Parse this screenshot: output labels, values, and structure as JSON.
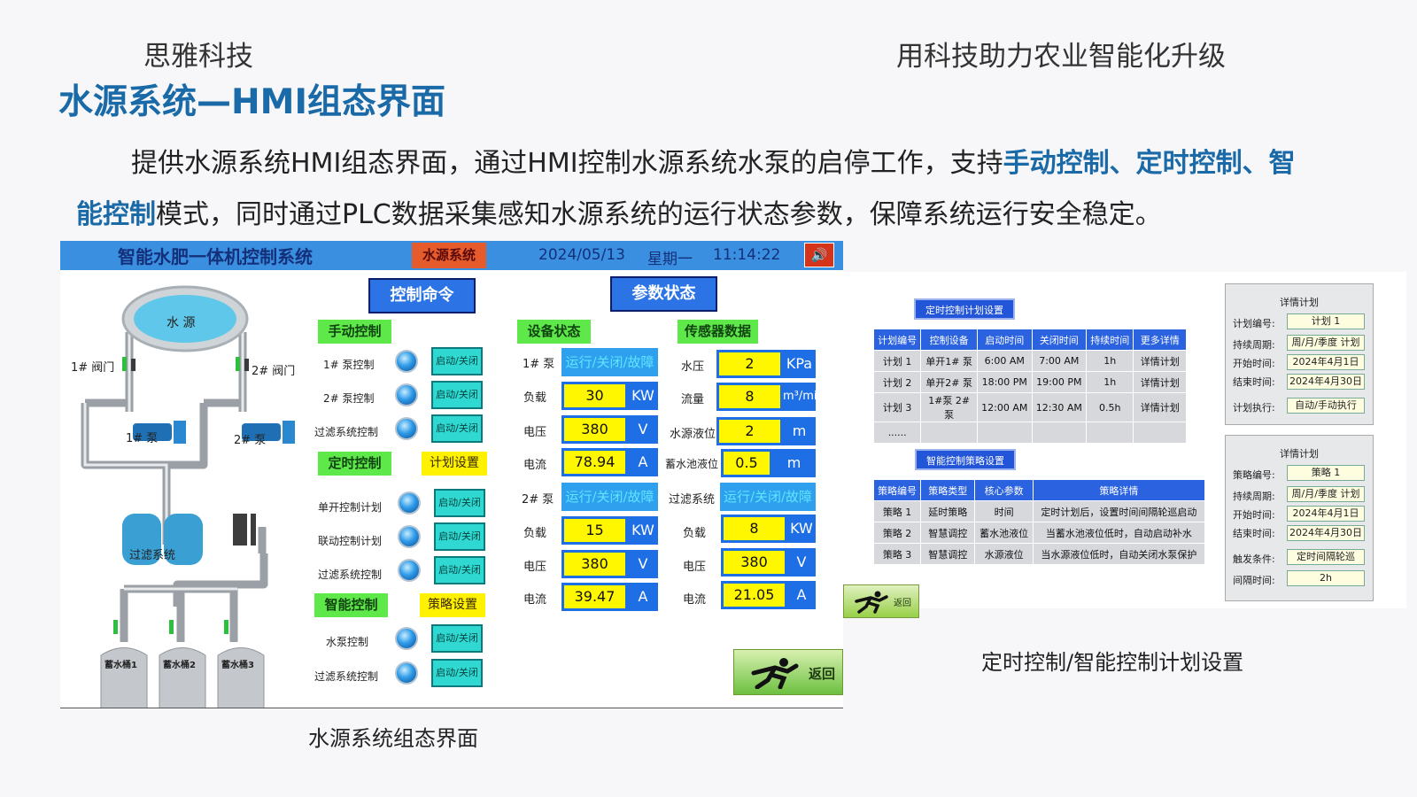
{
  "header": {
    "company": "思雅科技",
    "slogan": "用科技助力农业智能化升级",
    "title": "水源系统—HMI组态界面"
  },
  "description": {
    "p1": "提供水源系统HMI组态界面，通过HMI控制水源系统水泵的启停工作，支持",
    "h1": "手动控制、定时控制、智",
    "h2": "能控制",
    "p2": "模式，同时通过PLC数据采集感知水源系统的运行状态参数，保障系统运行安全稳定。"
  },
  "hmi": {
    "titlebar": {
      "title": "智能水肥一体机控制系统",
      "system": "水源系统",
      "date": "2024/05/13",
      "weekday": "星期一",
      "time": "11:14:22",
      "speaker": "🔊"
    },
    "diagram": {
      "water_source": "水 源",
      "valve1": "1# 阀门",
      "valve2": "2# 阀门",
      "pump1": "1# 泵",
      "pump2": "2# 泵",
      "filter": "过滤系统",
      "tank1": "蓄水桶1",
      "tank2": "蓄水桶2",
      "tank3": "蓄水桶3"
    },
    "control": {
      "header": "控制命令",
      "manual": {
        "label": "手动控制",
        "rows": [
          {
            "label": "1# 泵控制",
            "btn": "启动/关闭"
          },
          {
            "label": "2# 泵控制",
            "btn": "启动/关闭"
          },
          {
            "label": "过滤系统控制",
            "btn": "启动/关闭"
          }
        ]
      },
      "timed": {
        "label": "定时控制",
        "setting": "计划设置",
        "rows": [
          {
            "label": "单开控制计划",
            "btn": "启动/关闭"
          },
          {
            "label": "联动控制计划",
            "btn": "启动/关闭"
          },
          {
            "label": "过滤系统控制",
            "btn": "启动/关闭"
          }
        ]
      },
      "smart": {
        "label": "智能控制",
        "setting": "策略设置",
        "rows": [
          {
            "label": "水泵控制",
            "btn": "启动/关闭"
          },
          {
            "label": "过滤系统控制",
            "btn": "启动/关闭"
          }
        ]
      }
    },
    "params": {
      "header": "参数状态",
      "device_header": "设备状态",
      "sensor_header": "传感器数据",
      "pump1": {
        "label": "1# 泵",
        "status": "运行/关闭/故障",
        "load_label": "负载",
        "load": "30",
        "load_unit": "KW",
        "volt_label": "电压",
        "volt": "380",
        "volt_unit": "V",
        "cur_label": "电流",
        "cur": "78.94",
        "cur_unit": "A"
      },
      "pump2": {
        "label": "2# 泵",
        "status": "运行/关闭/故障",
        "load_label": "负载",
        "load": "15",
        "load_unit": "KW",
        "volt_label": "电压",
        "volt": "380",
        "volt_unit": "V",
        "cur_label": "电流",
        "cur": "39.47",
        "cur_unit": "A"
      },
      "sensors": {
        "pressure_label": "水压",
        "pressure": "2",
        "pressure_unit": "KPa",
        "flow_label": "流量",
        "flow": "8",
        "flow_unit": "m³/min",
        "level_label": "水源液位",
        "level": "2",
        "level_unit": "m",
        "pool_label": "蓄水池液位",
        "pool": "0.5",
        "pool_unit": "m"
      },
      "filter": {
        "label": "过滤系统",
        "status": "运行/关闭/故障",
        "load_label": "负载",
        "load": "8",
        "load_unit": "KW",
        "volt_label": "电压",
        "volt": "380",
        "volt_unit": "V",
        "cur_label": "电流",
        "cur": "21.05",
        "cur_unit": "A"
      }
    },
    "back": "返回",
    "caption": "水源系统组态界面"
  },
  "right": {
    "timed_header": "定时控制计划设置",
    "timed_table": {
      "columns": [
        "计划编号",
        "控制设备",
        "启动时间",
        "关闭时间",
        "持续时间",
        "更多详情"
      ],
      "rows": [
        [
          "计划 1",
          "单开1# 泵",
          "6:00 AM",
          "7:00 AM",
          "1h",
          "详情计划"
        ],
        [
          "计划 2",
          "单开2# 泵",
          "18:00 PM",
          "19:00 PM",
          "1h",
          "详情计划"
        ],
        [
          "计划 3",
          "1#泵 2# 泵",
          "12:00 AM",
          "12:30 AM",
          "0.5h",
          "详情计划"
        ],
        [
          "......",
          "",
          "",
          "",
          "",
          ""
        ]
      ]
    },
    "smart_header": "智能控制策略设置",
    "smart_table": {
      "columns": [
        "策略编号",
        "策略类型",
        "核心参数",
        "策略详情"
      ],
      "rows": [
        [
          "策略 1",
          "延时策略",
          "时间",
          "定时计划后，设置时间间隔轮巡启动"
        ],
        [
          "策略 2",
          "智慧调控",
          "蓄水池液位",
          "当蓄水池液位低时，自动启动补水"
        ],
        [
          "策略 3",
          "智慧调控",
          "水源液位",
          "当水源液位低时，自动关闭水泵保护"
        ]
      ]
    },
    "plan_card": {
      "title": "详情计划",
      "l1": "计划编号:",
      "v1": "计划 1",
      "l2": "持续周期:",
      "v2": "周/月/季度 计划",
      "l3": "开始时间:",
      "v3": "2024年4月1日",
      "l4": "结束时间:",
      "v4": "2024年4月30日",
      "l5": "计划执行:",
      "v5": "自动/手动执行"
    },
    "strategy_card": {
      "title": "详情计划",
      "l1": "策略编号:",
      "v1": "策略 1",
      "l2": "持续周期:",
      "v2": "周/月/季度 计划",
      "l3": "开始时间:",
      "v3": "2024年4月1日",
      "l4": "结束时间:",
      "v4": "2024年4月30日",
      "l5": "触发条件:",
      "v5": "定时间隔轮巡",
      "l6": "间隔时间:",
      "v6": "2h"
    },
    "back": "返回",
    "caption": "定时控制/智能控制计划设置"
  }
}
